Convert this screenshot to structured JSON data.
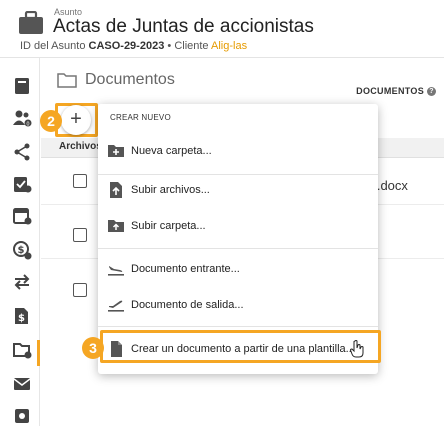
{
  "header": {
    "small_label": "Asunto",
    "title": "Actas de Juntas de accionistas",
    "id_label": "ID del Asunto",
    "case_id": "CASO-29-2023",
    "separator": "•",
    "client_label": "Cliente",
    "client_name": "Alig-las"
  },
  "main": {
    "title": "Documentos",
    "documents_column": "DOCUMENTOS",
    "archivos_label": "Archivos",
    "docx_fragment": "rs.docx"
  },
  "add_button": {
    "label": "+"
  },
  "badges": {
    "step2": "2",
    "step3": "3"
  },
  "menu": {
    "header": "CREAR NUEVO",
    "items": [
      {
        "label": "Nueva carpeta..."
      },
      {
        "label": "Subir archivos..."
      },
      {
        "label": "Subir carpeta..."
      },
      {
        "label": "Documento entrante..."
      },
      {
        "label": "Documento de salida..."
      },
      {
        "label": "Crear un documento a partir de una plantilla..."
      }
    ]
  },
  "colors": {
    "accent": "#f5a623",
    "link": "#e69b00"
  },
  "icons": {
    "sidebar": [
      "book-icon",
      "people-icon",
      "share-icon",
      "task-icon",
      "calendar-icon",
      "billing-icon",
      "transfer-icon",
      "invoice-icon",
      "folder-icon",
      "mail-icon",
      "settings-icon"
    ]
  }
}
